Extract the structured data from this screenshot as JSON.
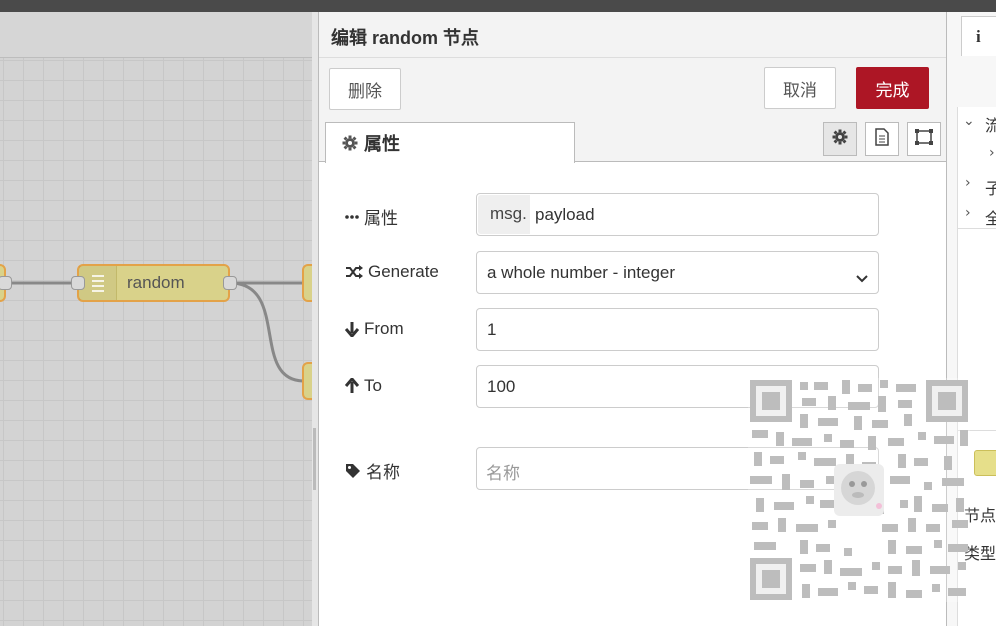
{
  "tray": {
    "title": "编辑 random 节点",
    "delete_label": "删除",
    "cancel_label": "取消",
    "done_label": "完成",
    "tab_properties": "属性"
  },
  "form": {
    "property": {
      "label": "属性",
      "prefix": "msg.",
      "value": "payload"
    },
    "generate": {
      "label": "Generate",
      "value": "a whole number - integer"
    },
    "from": {
      "label": "From",
      "value": "1"
    },
    "to": {
      "label": "To",
      "value": "100"
    },
    "name": {
      "label": "名称",
      "placeholder": "名称"
    }
  },
  "workspace": {
    "node_label": "random"
  },
  "sidebar": {
    "tab_icon": "i",
    "items": [
      "流",
      "子",
      "全"
    ],
    "info_labels": [
      "节点",
      "类型"
    ]
  },
  "colors": {
    "done_button": "#ad1625",
    "node_fill": "#d9d28a",
    "node_border": "#e3a248"
  },
  "icons": [
    "gear-icon",
    "document-icon",
    "frame-icon",
    "ellipsis-icon",
    "shuffle-icon",
    "arrow-down-icon",
    "arrow-up-icon",
    "tag-icon",
    "chevron-down-icon",
    "info-icon"
  ]
}
